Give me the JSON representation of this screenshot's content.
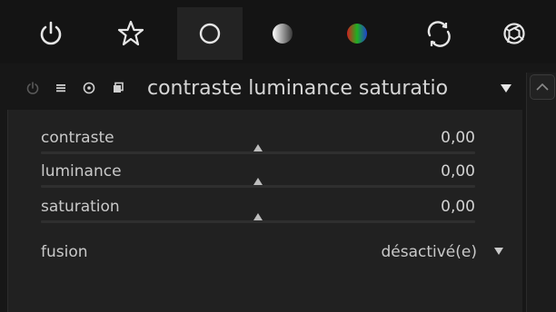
{
  "group_tabs": [
    {
      "name": "power",
      "icon": "power-icon"
    },
    {
      "name": "favorites",
      "icon": "star-icon"
    },
    {
      "name": "basic",
      "icon": "circle-outline-icon"
    },
    {
      "name": "tone",
      "icon": "gradient-circle-icon"
    },
    {
      "name": "color",
      "icon": "color-wheel-icon"
    },
    {
      "name": "correct",
      "icon": "refresh-arc-icon"
    },
    {
      "name": "effect",
      "icon": "aperture-icon"
    }
  ],
  "module": {
    "title": "contraste luminance saturatio",
    "header_icons": [
      "power-icon",
      "presets-icon",
      "reset-icon",
      "multi-instance-icon"
    ],
    "collapse_icon": "triangle-down-icon"
  },
  "sliders": [
    {
      "label": "contraste",
      "value": "0,00",
      "position": 0.5
    },
    {
      "label": "luminance",
      "value": "0,00",
      "position": 0.5
    },
    {
      "label": "saturation",
      "value": "0,00",
      "position": 0.5
    }
  ],
  "blend": {
    "label": "fusion",
    "value": "désactivé(e)"
  },
  "colors": {
    "background": "#171717",
    "panel": "#212121",
    "text": "#c9c9c9"
  }
}
